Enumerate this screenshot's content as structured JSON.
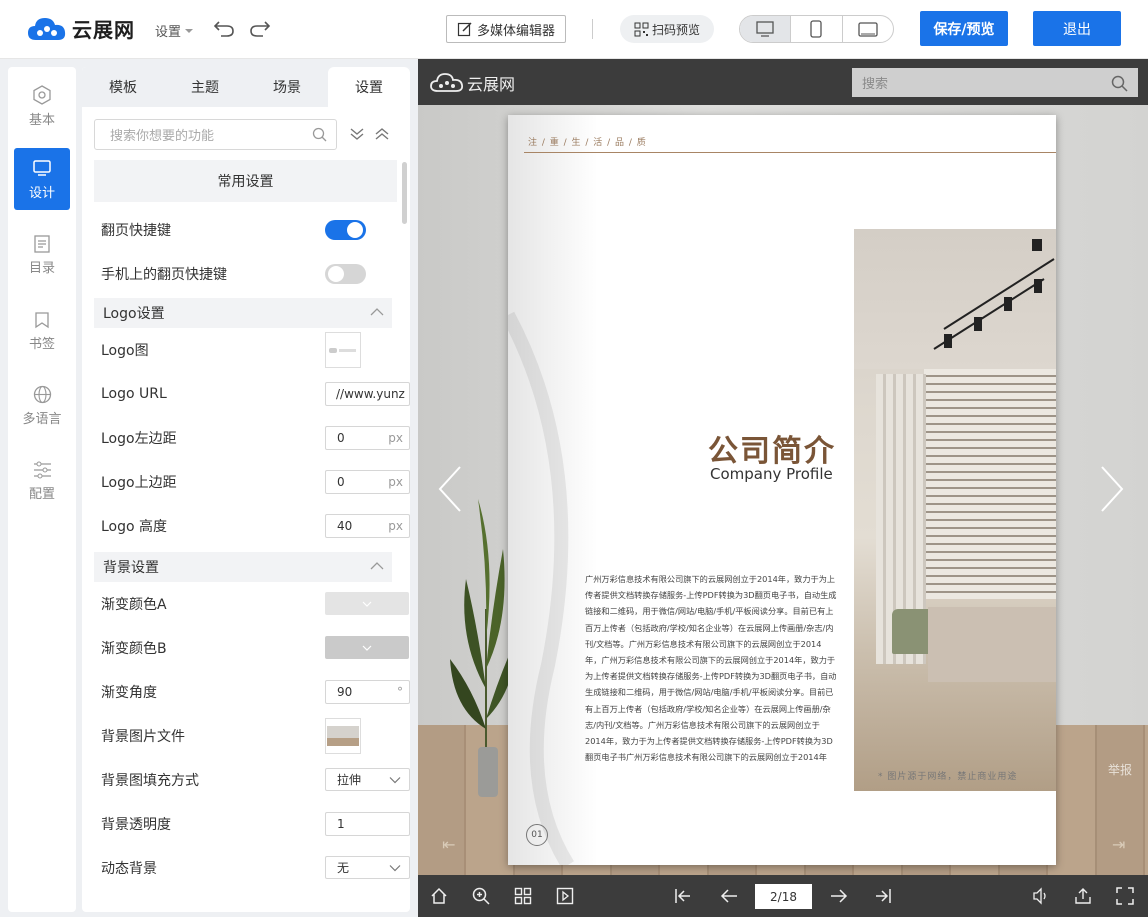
{
  "header": {
    "brand": "云展网",
    "settings_menu": "设置",
    "media_editor": "多媒体编辑器",
    "qr_preview": "扫码预览",
    "save_preview": "保存/预览",
    "exit": "退出"
  },
  "left_nav": {
    "items": [
      {
        "label": "基本",
        "icon": "hexagon-icon"
      },
      {
        "label": "设计",
        "icon": "monitor-icon"
      },
      {
        "label": "目录",
        "icon": "toc-icon"
      },
      {
        "label": "书签",
        "icon": "bookmark-icon"
      },
      {
        "label": "多语言",
        "icon": "globe-icon"
      },
      {
        "label": "配置",
        "icon": "sliders-icon"
      }
    ],
    "active": "设计"
  },
  "panel": {
    "tabs": [
      "模板",
      "主题",
      "场景",
      "设置"
    ],
    "active_tab": "设置",
    "search_placeholder": "搜索你想要的功能",
    "common_settings": "常用设置",
    "page_flip_shortcut": "翻页快捷键",
    "mobile_page_flip_shortcut": "手机上的翻页快捷键",
    "logo_section": "Logo设置",
    "logo_image": "Logo图",
    "logo_url_label": "Logo URL",
    "logo_url_value": "//www.yunz",
    "logo_left_label": "Logo左边距",
    "logo_left_value": "0",
    "logo_top_label": "Logo上边距",
    "logo_top_value": "0",
    "logo_height_label": "Logo 高度",
    "logo_height_value": "40",
    "unit_px": "px",
    "bg_section": "背景设置",
    "gradient_a": "渐变颜色A",
    "gradient_b": "渐变颜色B",
    "gradient_angle_label": "渐变角度",
    "gradient_angle_value": "90",
    "unit_deg": "°",
    "bg_image_file": "背景图片文件",
    "bg_fill_label": "背景图填充方式",
    "bg_fill_value": "拉伸",
    "bg_opacity_label": "背景透明度",
    "bg_opacity_value": "1",
    "dynamic_bg_label": "动态背景",
    "dynamic_bg_value": "无"
  },
  "toggles": {
    "page_flip_shortcut": true,
    "mobile_page_flip_shortcut": false
  },
  "colors": {
    "accent": "#1a73e8",
    "gradient_a": "#e4e4e4",
    "gradient_b": "#cacaca",
    "title_brown": "#7a5537"
  },
  "viewer": {
    "brand": "云展网",
    "search_placeholder": "搜索",
    "page_indicator": "2/18",
    "report": "举报",
    "book": {
      "tagline": "注 / 重 / 生 / 活 / 品 / 质",
      "title_cn": "公司简介",
      "title_en": "Company Profile",
      "body": "广州万彩信息技术有限公司旗下的云展网创立于2014年，致力于为上传者提供文档转换存储服务-上传PDF转换为3D翻页电子书，自动生成链接和二维码，用于微信/网站/电脑/手机/平板阅读分享。目前已有上百万上传者（包括政府/学校/知名企业等）在云展网上传画册/杂志/内刊/文档等。广州万彩信息技术有限公司旗下的云展网创立于2014年，广州万彩信息技术有限公司旗下的云展网创立于2014年，致力于为上传者提供文档转换存储服务-上传PDF转换为3D翻页电子书，自动生成链接和二维码，用于微信/网站/电脑/手机/平板阅读分享。目前已有上百万上传者（包括政府/学校/知名企业等）在云展网上传画册/杂志/内刊/文档等。广州万彩信息技术有限公司旗下的云展网创立于2014年，致力于为上传者提供文档转换存储服务-上传PDF转换为3D翻页电子书广州万彩信息技术有限公司旗下的云展网创立于2014年",
      "caption": "* 图片源于网络，禁止商业用途",
      "page_number": "01"
    }
  }
}
